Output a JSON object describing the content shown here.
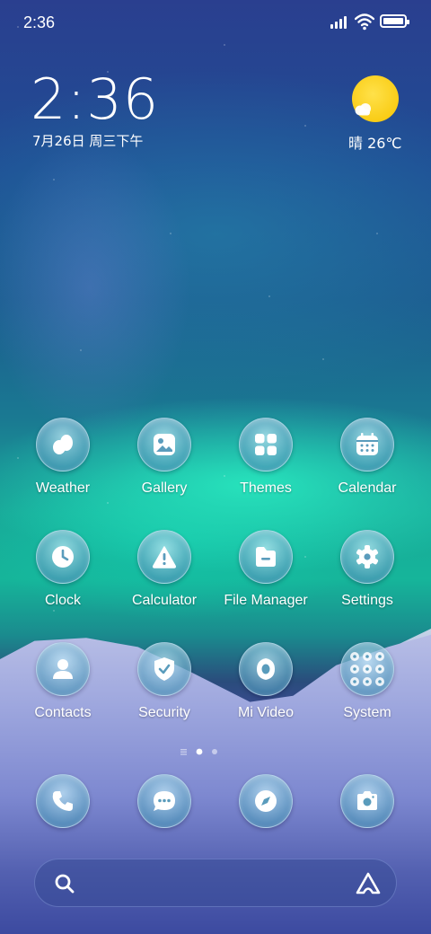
{
  "status_bar": {
    "time": "2:36",
    "signal_icon": "signal-bars-icon",
    "wifi_icon": "wifi-icon",
    "battery_icon": "battery-icon"
  },
  "clock_widget": {
    "time": "2:36",
    "date": "7月26日 周三下午"
  },
  "weather_widget": {
    "icon": "sun-cloud-icon",
    "text": "晴 26℃"
  },
  "apps": [
    {
      "label": "Weather",
      "icon": "weather-icon"
    },
    {
      "label": "Gallery",
      "icon": "gallery-icon"
    },
    {
      "label": "Themes",
      "icon": "themes-icon"
    },
    {
      "label": "Calendar",
      "icon": "calendar-icon"
    },
    {
      "label": "Clock",
      "icon": "clock-icon"
    },
    {
      "label": "Calculator",
      "icon": "calculator-icon"
    },
    {
      "label": "File Manager",
      "icon": "file-manager-icon"
    },
    {
      "label": "Settings",
      "icon": "settings-icon"
    },
    {
      "label": "Contacts",
      "icon": "contacts-icon"
    },
    {
      "label": "Security",
      "icon": "security-icon"
    },
    {
      "label": "Mi Video",
      "icon": "mi-video-icon"
    },
    {
      "label": "System",
      "icon": "system-folder-icon"
    }
  ],
  "pager": {
    "pages": 3,
    "current": 2
  },
  "dock": [
    {
      "icon": "phone-icon"
    },
    {
      "icon": "messages-icon"
    },
    {
      "icon": "browser-icon"
    },
    {
      "icon": "camera-icon"
    }
  ],
  "search_bar": {
    "search_icon": "search-icon",
    "assistant_icon": "assistant-icon"
  },
  "colors": {
    "accent_sun": "#f7c400",
    "icon_glass": "#5aa0c0"
  }
}
